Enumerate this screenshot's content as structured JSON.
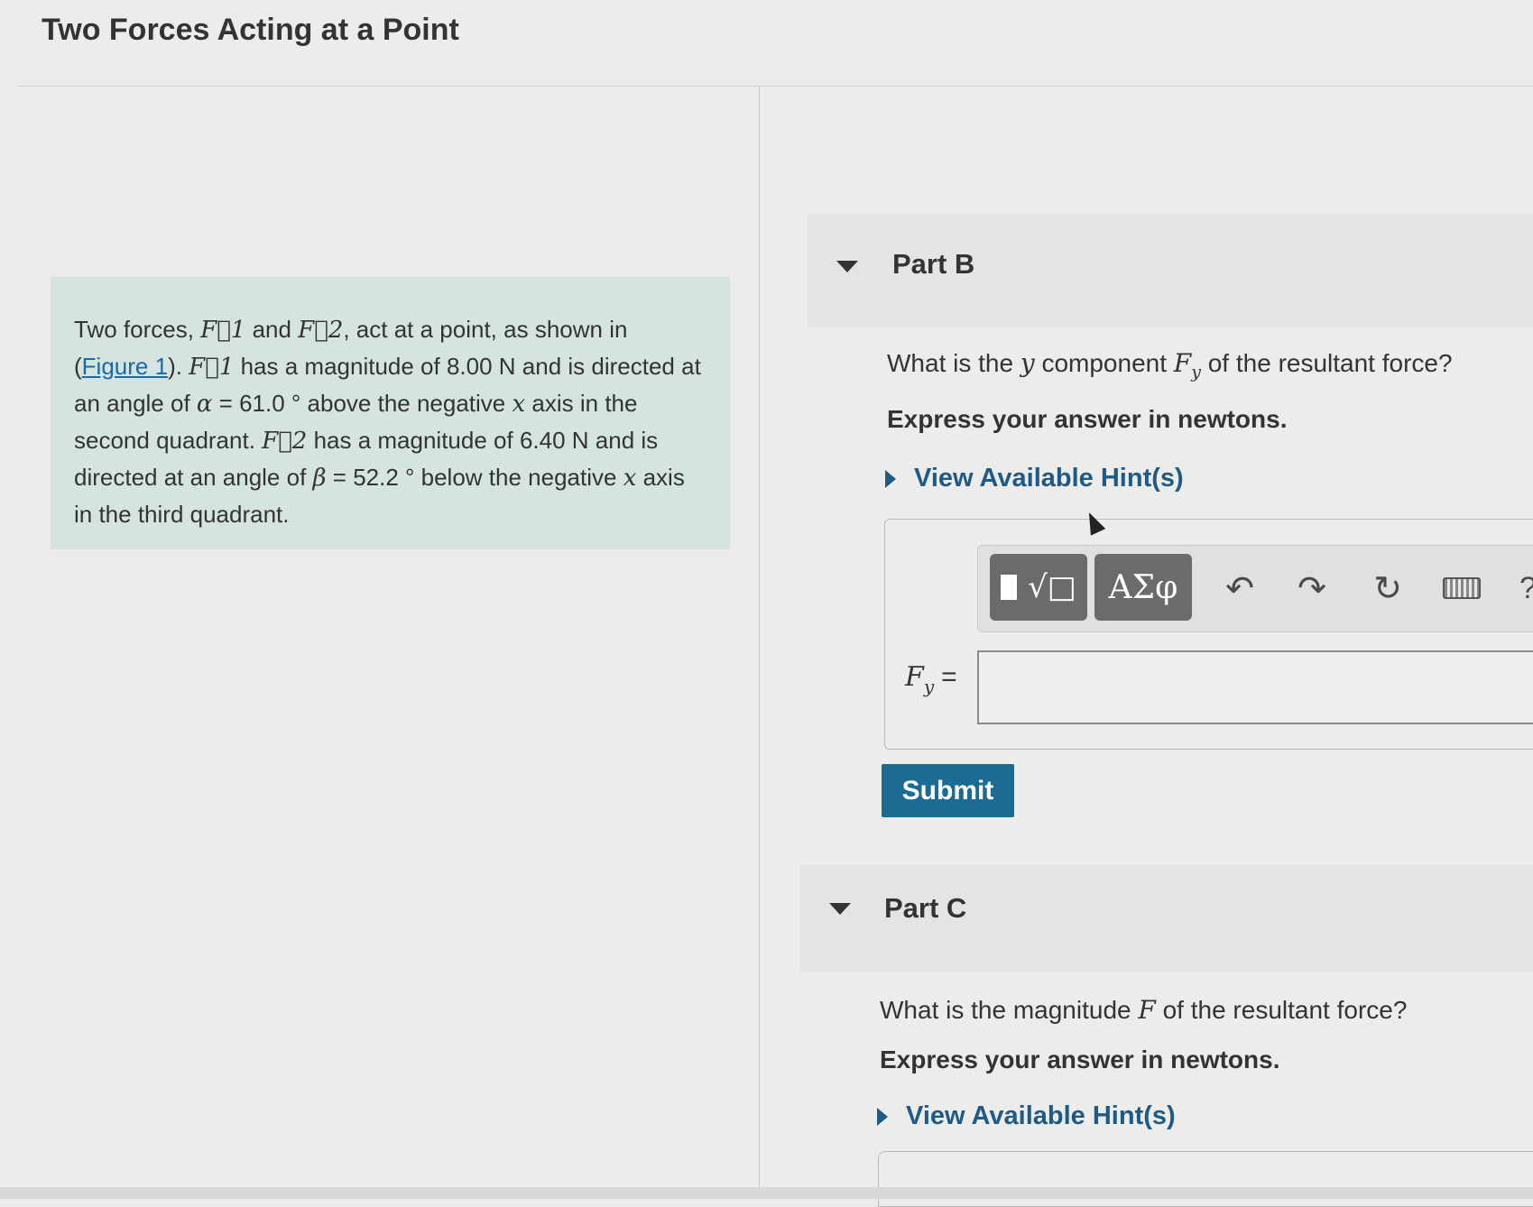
{
  "page": {
    "title": "Two Forces Acting at a Point"
  },
  "intro": {
    "t1": "Two forces, ",
    "f1": "F⃗1",
    "t2": " and ",
    "f2": "F⃗2",
    "t3": ", act at a point, as shown in (",
    "figure_link": "Figure 1",
    "t4": "). ",
    "f1b": "F⃗1",
    "t5": " has a magnitude of 8.00 N and is directed at an angle of ",
    "alpha": "α",
    "t6": " = 61.0 ° above the negative ",
    "x1": "x",
    "t7": " axis in the second quadrant. ",
    "f2b": "F⃗2",
    "t8": " has a magnitude of 6.40 N and is directed at an angle of ",
    "beta": "β",
    "t9": " = 52.2 ° below the negative ",
    "x2": "x",
    "t10": " axis in the third quadrant."
  },
  "part_b": {
    "label": "Part B",
    "q1": "What is the ",
    "q_y": "y",
    "q2": " component ",
    "q_F": "F",
    "q_sub": "y",
    "q3": " of the resultant force?",
    "instruction": "Express your answer in newtons.",
    "hint": "View Available Hint(s)",
    "toolbar": {
      "templates_icon": "√□",
      "symbols_label": "ΑΣφ",
      "undo_icon": "↶",
      "redo_icon": "↷",
      "reset_icon": "↻",
      "help_icon": "?"
    },
    "answer_label_F": "F",
    "answer_label_sub": "y",
    "answer_label_eq": "=",
    "answer_value": "",
    "submit_label": "Submit"
  },
  "part_c": {
    "label": "Part C",
    "q1": "What is the magnitude ",
    "q_F": "F",
    "q2": " of the resultant force?",
    "instruction": "Express your answer in newtons.",
    "hint": "View Available Hint(s)"
  }
}
